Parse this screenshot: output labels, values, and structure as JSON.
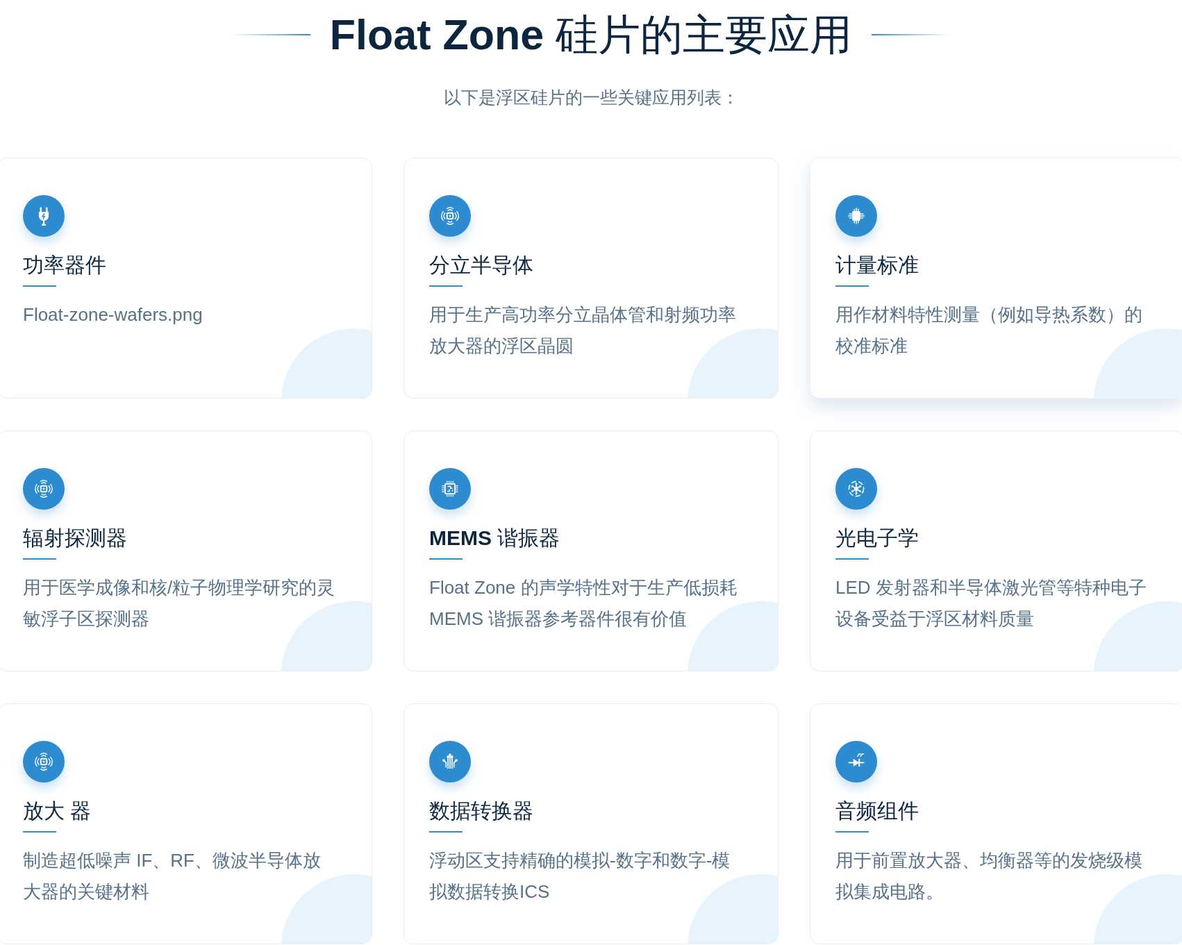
{
  "header": {
    "title": "**Float Zone** 硅片的主要应用",
    "subtitle": "以下是浮区硅片的一些关键应用列表："
  },
  "cards": [
    {
      "kind": "plug",
      "title": "功率器件",
      "text": "Float-zone-wafers.png",
      "elevated": false
    },
    {
      "kind": "chip-signal",
      "title": "分立半导体",
      "text": "用于生产高功率分立晶体管和射频功率放大器的浮区晶圆",
      "elevated": false
    },
    {
      "kind": "chip",
      "title": "计量标准",
      "text": "用作材料特性测量（例如导热系数）的校准标准",
      "elevated": true
    },
    {
      "kind": "chip-signal",
      "title": "辐射探测器",
      "text": "用于医学成像和核/粒子物理学研究的灵敏浮子区探测器",
      "elevated": false
    },
    {
      "kind": "chip-circuit",
      "title": "**MEMS** 谐振器",
      "text": "Float Zone 的声学特性对于生产低损耗 MEMS 谐振器参考器件很有价值",
      "elevated": false
    },
    {
      "kind": "atom",
      "title": "光电子学",
      "text": "LED 发射器和半导体激光管等特种电子设备受益于浮区材料质量",
      "elevated": false
    },
    {
      "kind": "chip-signal",
      "title": "放大 器",
      "text": "制造超低噪声 IF、RF、微波半导体放大器的关键材料",
      "elevated": false
    },
    {
      "kind": "circuit",
      "title": "数据转换器",
      "text": "浮动区支持精确的模拟-数字和数字-模拟数据转换ICS",
      "elevated": false
    },
    {
      "kind": "diode",
      "title": "音频组件",
      "text": "用于前置放大器、均衡器等的发烧级模拟集成电路。",
      "elevated": false
    }
  ]
}
